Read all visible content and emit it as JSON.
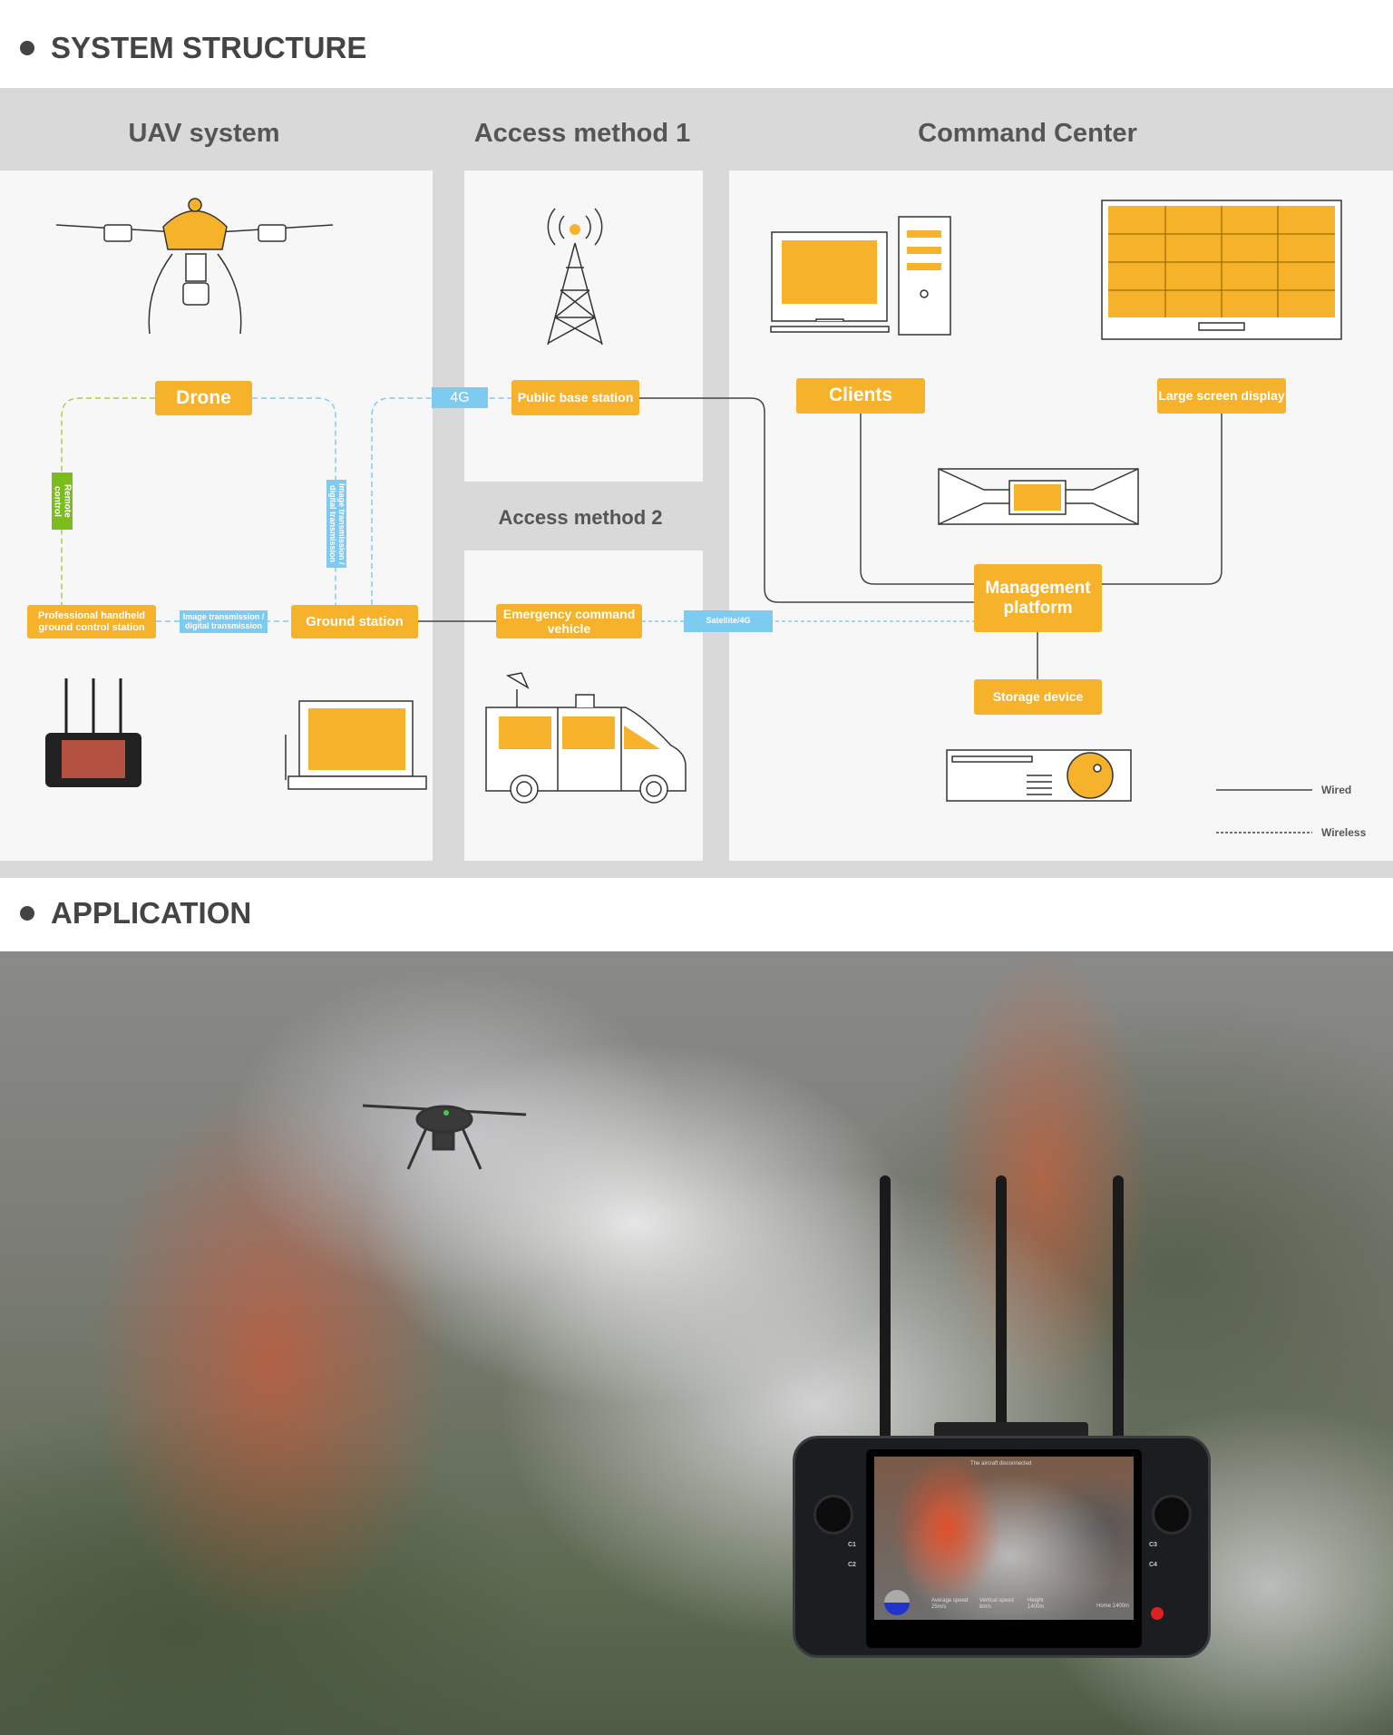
{
  "sections": {
    "structure_title": "SYSTEM STRUCTURE",
    "application_title": "APPLICATION"
  },
  "columns": {
    "uav": "UAV system",
    "access1": "Access method 1",
    "access2": "Access method 2",
    "command": "Command Center"
  },
  "nodes": {
    "drone": "Drone",
    "handheld": "Professional handheld ground control station",
    "ground_station": "Ground station",
    "public_base": "Public base station",
    "emergency_vehicle": "Emergency command vehicle",
    "clients": "Clients",
    "large_screen": "Large screen display",
    "management": "Management platform",
    "storage": "Storage device"
  },
  "links": {
    "remote_control": "Remote control",
    "image_vertical": "Image transmission / digital transmission",
    "image_horizontal": "Image transmission / digital transmission",
    "g4": "4G",
    "satellite": "Satellite/4G"
  },
  "legend": {
    "wired": "Wired",
    "wireless": "Wireless"
  },
  "controller_screen": {
    "status": "The aircraft disconnected",
    "avg_speed_label": "Average speed",
    "avg_speed": "25m/s",
    "vert_speed_label": "Vertical speed",
    "vert_speed": "8m/s",
    "height_label": "Height",
    "height": "1400m",
    "home": "Home 1400m",
    "buttons": [
      "C1",
      "C2",
      "C3",
      "C4"
    ]
  },
  "colors": {
    "accent": "#f7b22b",
    "wireless_blue": "#7ecbf2",
    "remote_green": "#7cbd1e",
    "panel_bg": "#f7f7f7",
    "section_bg": "#d9d9d9"
  }
}
